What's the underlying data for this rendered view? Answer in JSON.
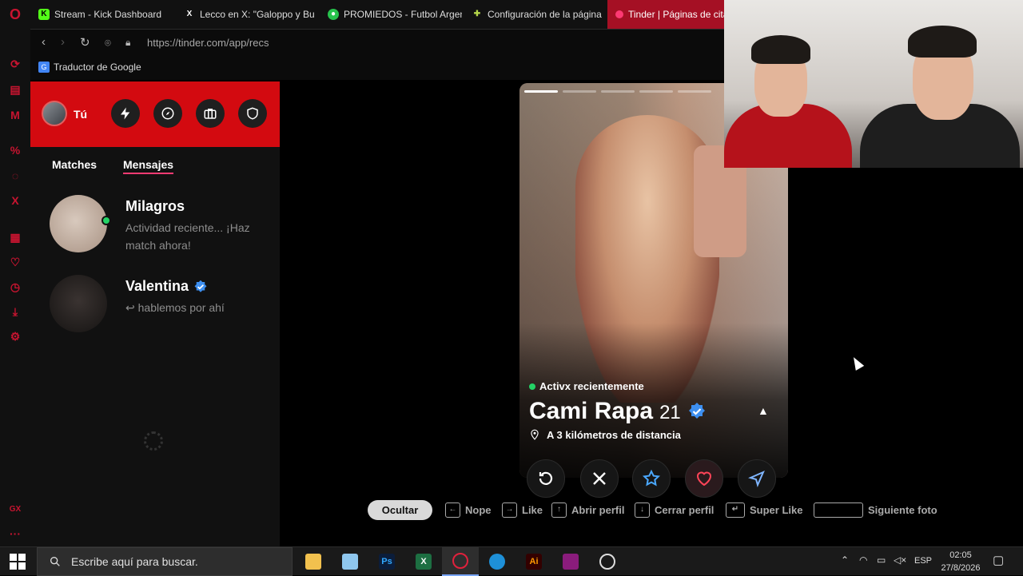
{
  "browser": {
    "tabs": [
      {
        "label": "Stream - Kick Dashboard",
        "icon": "kick-icon",
        "icon_color": "#53fc18"
      },
      {
        "label": "Lecco en X: \"Galoppo y Bu",
        "icon": "x-icon",
        "icon_color": "#ffffff"
      },
      {
        "label": "PROMIEDOS - Futbol Argen",
        "icon": "promiedos-icon",
        "icon_color": "#27c24c"
      },
      {
        "label": "Configuración de la página",
        "icon": "puzzle-icon",
        "icon_color": "#b4d64a"
      },
      {
        "label": "Tinder | Páginas de cita",
        "icon": "tinder-icon",
        "icon_color": "#fd3a73"
      }
    ],
    "url": "https://tinder.com/app/recs",
    "bookmark_translate": "Traductor de Google"
  },
  "tinder": {
    "me_label": "Tú",
    "tabs": {
      "matches": "Matches",
      "mensajes": "Mensajes"
    },
    "conversations": [
      {
        "name": "Milagros",
        "message": "Actividad reciente... ¡Haz match ahora!",
        "online": true,
        "verified": false
      },
      {
        "name": "Valentina",
        "message": "↩ hablemos por ahí",
        "online": false,
        "verified": true
      }
    ],
    "card": {
      "status": "Activx recientemente",
      "name": "Cami Rapa",
      "age": "21",
      "verified": true,
      "distance": "A 3 kilómetros de distancia",
      "photo_count": 5,
      "current_photo": 1
    },
    "hints": {
      "ocultar": "Ocultar",
      "nope": "Nope",
      "like": "Like",
      "abrir_perfil": "Abrir perfil",
      "cerrar_perfil": "Cerrar perfil",
      "super_like": "Super Like",
      "siguiente_foto": "Siguiente foto"
    },
    "colors": {
      "brand": "#d30a10",
      "accent": "#fd3a73",
      "online": "#24d366",
      "verified": "#3d8ff0"
    }
  },
  "taskbar": {
    "search_placeholder": "Escribe aquí para buscar.",
    "lang": "ESP",
    "time": "02:05",
    "date": "27/8/2026"
  }
}
